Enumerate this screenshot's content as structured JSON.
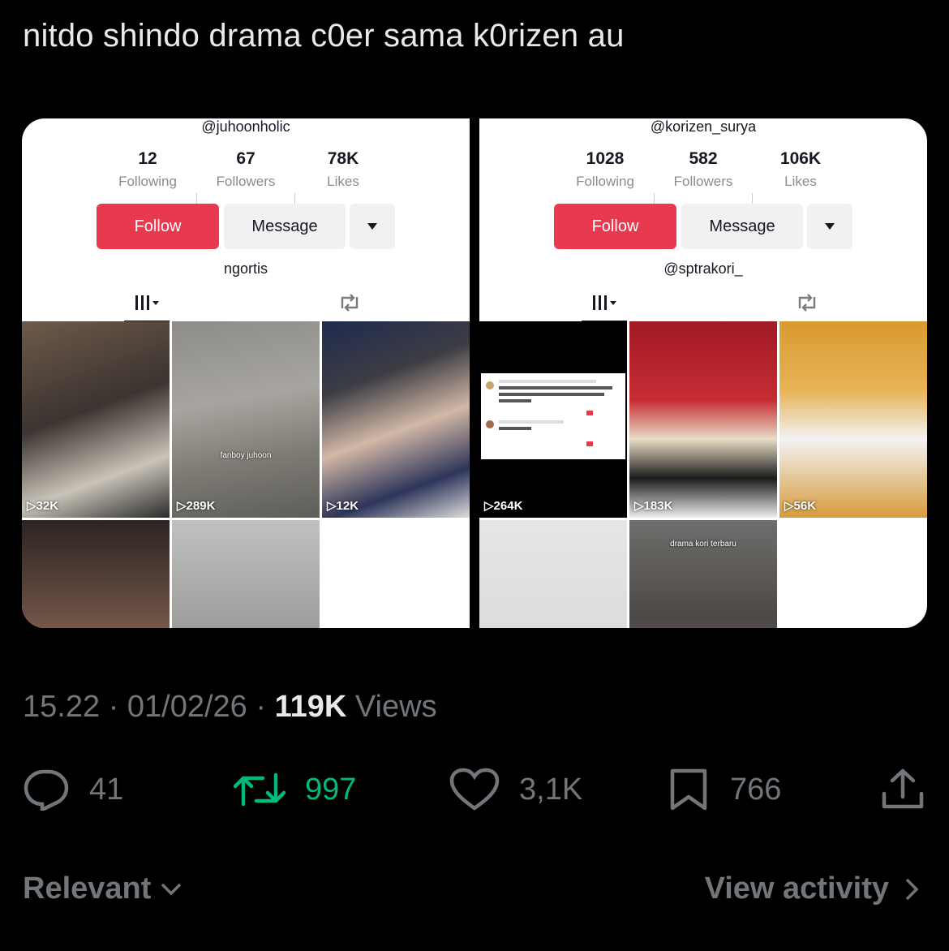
{
  "tweet": {
    "text": "nitdo shindo drama c0er sama k0rizen au"
  },
  "left_profile": {
    "handle": "@juhoonholic",
    "following_count": "12",
    "following_label": "Following",
    "followers_count": "67",
    "followers_label": "Followers",
    "likes_count": "78K",
    "likes_label": "Likes",
    "follow_label": "Follow",
    "message_label": "Message",
    "bio": "ngortis",
    "videos": [
      {
        "views": "32K"
      },
      {
        "views": "289K",
        "overlay": "fanboy juhoon"
      },
      {
        "views": "12K"
      },
      {
        "views": ""
      },
      {
        "views": ""
      }
    ]
  },
  "right_profile": {
    "handle": "@korizen_surya",
    "following_count": "1028",
    "following_label": "Following",
    "followers_count": "582",
    "followers_label": "Followers",
    "likes_count": "106K",
    "likes_label": "Likes",
    "follow_label": "Follow",
    "message_label": "Message",
    "bio": "@sptrakori_",
    "videos": [
      {
        "views": "264K"
      },
      {
        "views": "183K"
      },
      {
        "views": "56K"
      },
      {
        "views": ""
      },
      {
        "views": "",
        "overlay": "drama kori terbaru"
      }
    ]
  },
  "meta": {
    "time": "15.22",
    "date": "01/02/26",
    "views_count": "119K",
    "views_label": "Views",
    "sep": "·"
  },
  "actions": {
    "replies": "41",
    "reposts": "997",
    "likes": "3,1K",
    "bookmarks": "766"
  },
  "footer": {
    "sort_label": "Relevant",
    "activity_label": "View activity"
  },
  "colors": {
    "background": "#000000",
    "follow_red": "#e8394f",
    "repost_green": "#00ba7c",
    "muted": "#71767b"
  }
}
